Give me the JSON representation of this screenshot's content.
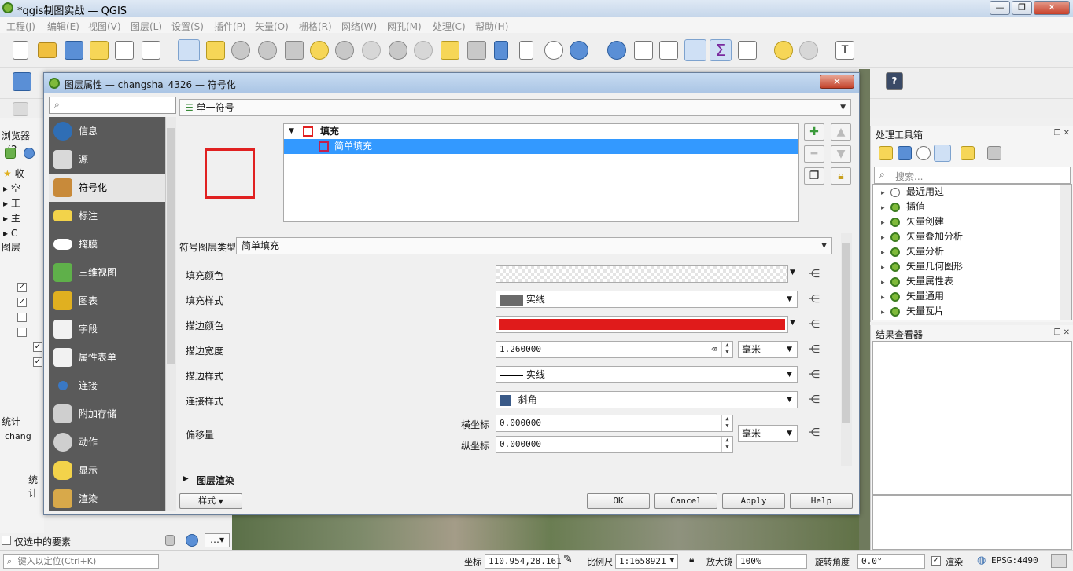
{
  "main_window": {
    "title": "*qgis制图实战 — QGIS",
    "controls": {
      "minimize": "—",
      "maximize": "❐",
      "close": "✕"
    }
  },
  "menubar": [
    "工程(J)",
    "编辑(E)",
    "视图(V)",
    "图层(L)",
    "设置(S)",
    "插件(P)",
    "矢量(O)",
    "栅格(R)",
    "网络(W)",
    "网孔(M)",
    "处理(C)",
    "帮助(H)"
  ],
  "left_panels": {
    "browser_title": "浏览器（2",
    "browser_items": [
      "收",
      "空",
      "工",
      "主",
      "C"
    ],
    "layers_title": "图层",
    "stats_title": "统计",
    "stats_layer": "chang",
    "stats_button": "统计",
    "selected_only": "仅选中的要素"
  },
  "processing": {
    "title": "处理工具箱",
    "search_placeholder": "搜索...",
    "items": [
      "最近用过",
      "插值",
      "矢量创建",
      "矢量叠加分析",
      "矢量分析",
      "矢量几何图形",
      "矢量属性表",
      "矢量通用",
      "矢量瓦片"
    ]
  },
  "results": {
    "title": "结果查看器"
  },
  "dialog": {
    "title": "图层属性 — changsha_4326 — 符号化",
    "close": "✕",
    "nav": [
      {
        "label": "信息",
        "icon": "info-icon"
      },
      {
        "label": "源",
        "icon": "source-icon"
      },
      {
        "label": "符号化",
        "icon": "symbology-icon"
      },
      {
        "label": "标注",
        "icon": "labels-icon"
      },
      {
        "label": "掩膜",
        "icon": "mask-icon"
      },
      {
        "label": "三维视图",
        "icon": "3d-view-icon"
      },
      {
        "label": "图表",
        "icon": "diagrams-icon"
      },
      {
        "label": "字段",
        "icon": "fields-icon"
      },
      {
        "label": "属性表单",
        "icon": "attributes-form-icon"
      },
      {
        "label": "连接",
        "icon": "joins-icon"
      },
      {
        "label": "附加存储",
        "icon": "auxiliary-storage-icon"
      },
      {
        "label": "动作",
        "icon": "actions-icon"
      },
      {
        "label": "显示",
        "icon": "display-icon"
      },
      {
        "label": "渲染",
        "icon": "rendering-icon"
      }
    ],
    "renderer": "单一符号",
    "symbol_tree": {
      "parent": "填充",
      "child": "简单填充"
    },
    "symbol_layer_type_label": "符号图层类型",
    "symbol_layer_type": "简单填充",
    "properties": {
      "fill_color_label": "填充颜色",
      "fill_style_label": "填充样式",
      "fill_style": "实线",
      "stroke_color_label": "描边颜色",
      "stroke_color": "#e01b1b",
      "stroke_width_label": "描边宽度",
      "stroke_width": "1.260000",
      "stroke_width_unit": "毫米",
      "stroke_style_label": "描边样式",
      "stroke_style": "实线",
      "join_style_label": "连接样式",
      "join_style": "斜角",
      "offset_label": "偏移量",
      "offset_x_label": "横坐标",
      "offset_x": "0.000000",
      "offset_y_label": "纵坐标",
      "offset_y": "0.000000",
      "offset_unit": "毫米"
    },
    "layer_rendering": "图层渲染",
    "style_button": "样式",
    "buttons": {
      "ok": "OK",
      "cancel": "Cancel",
      "apply": "Apply",
      "help": "Help"
    }
  },
  "statusbar": {
    "locate_placeholder": "键入以定位(Ctrl+K)",
    "coord_label": "坐标",
    "coord": "110.954,28.161",
    "scale_label": "比例尺",
    "scale": "1:1658921",
    "magnifier_label": "放大镜",
    "magnifier": "100%",
    "rotation_label": "旋转角度",
    "rotation": "0.0°",
    "render_label": "渲染",
    "crs": "EPSG:4490"
  },
  "colors": {
    "accent": "#3399ff",
    "stroke": "#e01b1b",
    "nav_bg": "#5a5a5a"
  }
}
